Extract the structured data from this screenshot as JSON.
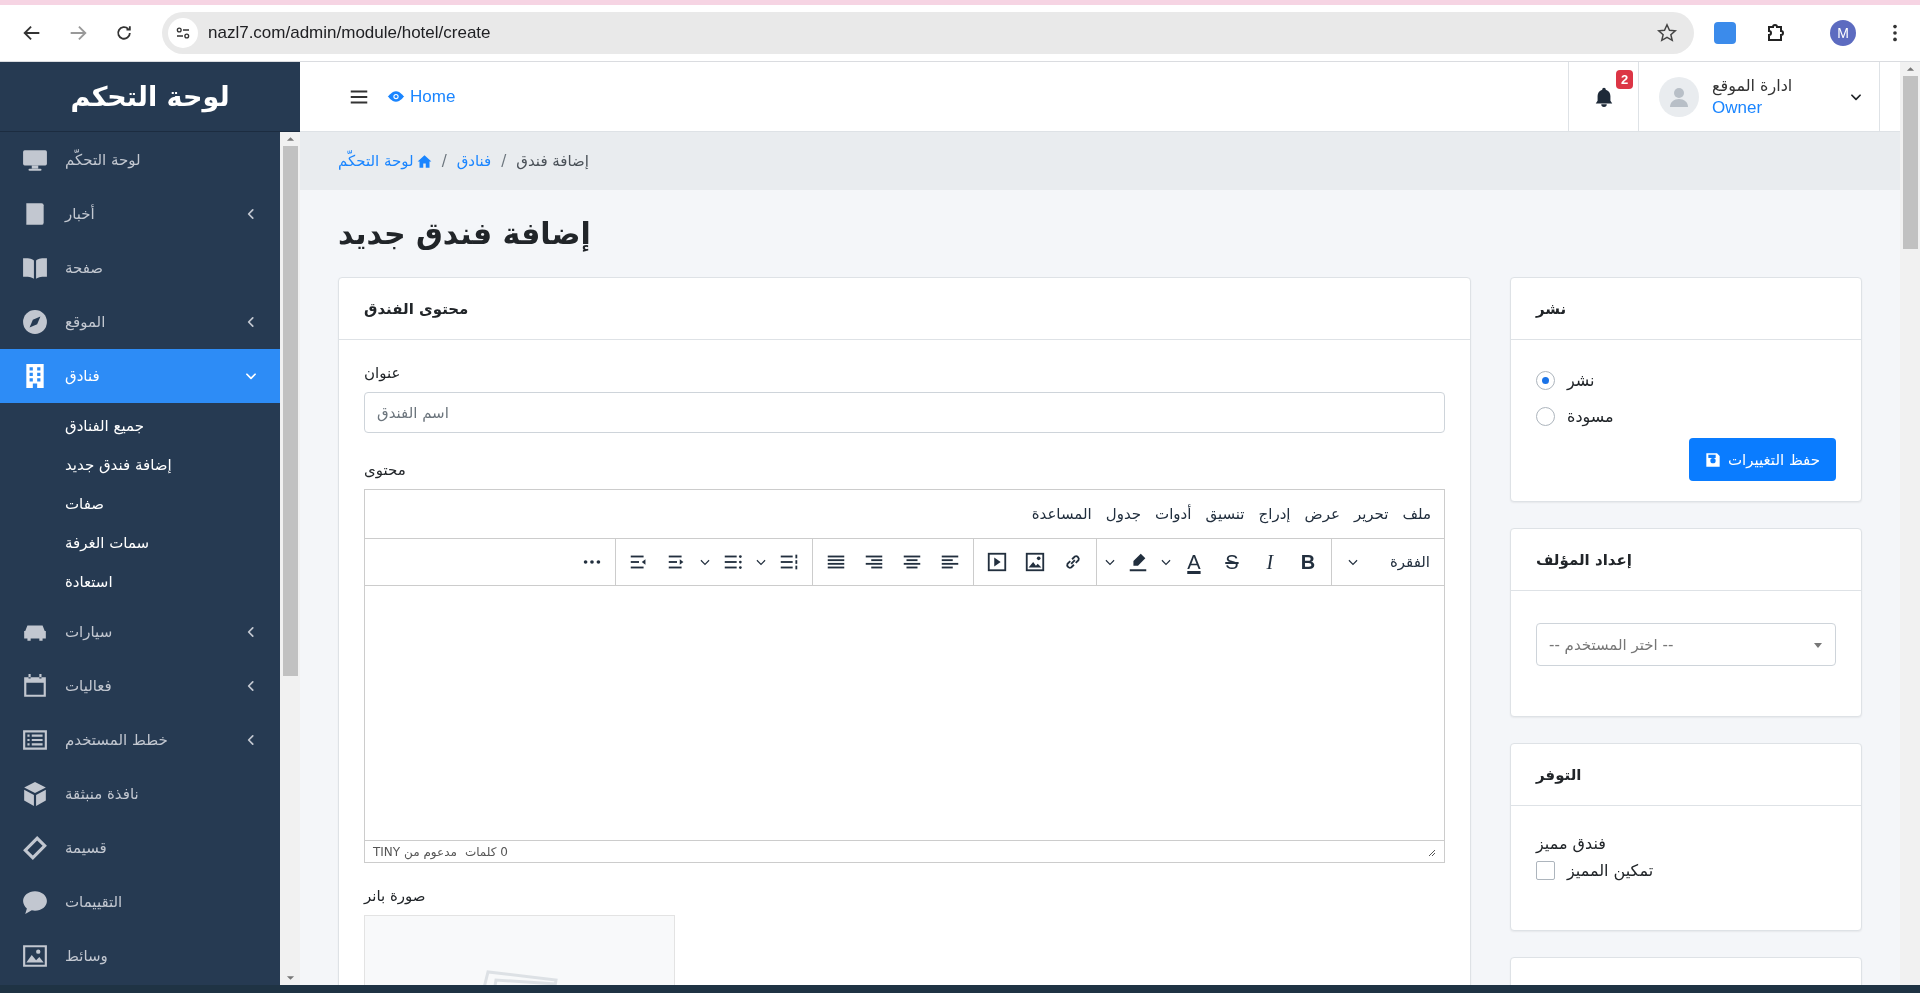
{
  "browser": {
    "url": "nazl7.com/admin/module/hotel/create",
    "profile_initial": "M"
  },
  "sidebar": {
    "brand": "لوحة التحكم",
    "items": [
      {
        "label": "لوحة التحكّم",
        "selected": false
      },
      {
        "label": "أخبار",
        "has_submenu": true,
        "expanded": false,
        "selected": false
      },
      {
        "label": "صفحة",
        "selected": false
      },
      {
        "label": "الموقع",
        "has_submenu": true,
        "expanded": false,
        "selected": false
      },
      {
        "label": "فنادق",
        "has_submenu": true,
        "expanded": true,
        "selected": true,
        "children": [
          {
            "label": "جميع الفنادق"
          },
          {
            "label": "إضافة فندق جديد"
          },
          {
            "label": "صفات"
          },
          {
            "label": "سمات الغرفة"
          },
          {
            "label": "استعادة"
          }
        ]
      },
      {
        "label": "سيارات",
        "has_submenu": true,
        "expanded": false,
        "selected": false
      },
      {
        "label": "فعاليات",
        "has_submenu": true,
        "expanded": false,
        "selected": false
      },
      {
        "label": "خطط المستخدم",
        "has_submenu": true,
        "expanded": false,
        "selected": false
      },
      {
        "label": "نافذة منبثقة",
        "selected": false
      },
      {
        "label": "قسيمة",
        "selected": false
      },
      {
        "label": "التقييمات",
        "selected": false
      },
      {
        "label": "وسائط",
        "selected": false
      }
    ]
  },
  "header": {
    "home_link": "Home",
    "notification_count": "2",
    "user": {
      "name": "ادارة الموقع",
      "role": "Owner"
    }
  },
  "breadcrumb": [
    {
      "label": "إضافة فندق",
      "link": false
    },
    {
      "label": "فنادق",
      "link": true,
      "separator": "/"
    },
    {
      "label": "لوحة التحكّم",
      "link": true,
      "separator": "/"
    }
  ],
  "page_title": "إضافة فندق جديد",
  "content_card": {
    "title": "محتوى الفندق",
    "title_field": {
      "label": "عنوان",
      "placeholder": "اسم الفندق"
    },
    "content_field": {
      "label": "محتوى",
      "editor": {
        "menu": [
          "ملف",
          "تحرير",
          "عرض",
          "إدراج",
          "تنسيق",
          "أدوات",
          "جدول",
          "المساعدة"
        ],
        "block_format": "الفقرة",
        "format_buttons": [
          {
            "label": "B",
            "kind": "bold"
          },
          {
            "label": "I",
            "kind": "italic"
          },
          {
            "label": "S",
            "kind": "strike"
          },
          {
            "label": "A",
            "kind": "color"
          }
        ],
        "status_words": "0 كلمات",
        "status_brand": "مدعوم من TINY"
      }
    },
    "banner": {
      "label": "صورة بانر"
    }
  },
  "publish_card": {
    "title": "نشر",
    "options": [
      {
        "label": "نشر",
        "selected": true
      },
      {
        "label": "مسودة",
        "selected": false
      }
    ],
    "save_button": "حفظ التغييرات"
  },
  "author_card": {
    "title": "إعداد المؤلف",
    "select_placeholder": "-- اختر المستخدم --"
  },
  "availability_card": {
    "title": "التوفر",
    "featured_label": "فندق مميز",
    "featured_checkbox": {
      "label": "تمكين المميز",
      "checked": false
    }
  }
}
